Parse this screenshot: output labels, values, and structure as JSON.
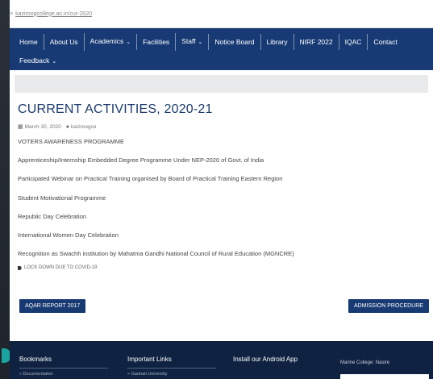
{
  "browser": {
    "url": "kaziroogcollege.ac.in/cur-2020"
  },
  "nav": {
    "row1": [
      {
        "label": "Home",
        "dropdown": false
      },
      {
        "label": "About Us",
        "dropdown": false
      },
      {
        "label": "Academics",
        "dropdown": true
      },
      {
        "label": "Facilities",
        "dropdown": false
      },
      {
        "label": "Staff",
        "dropdown": true
      },
      {
        "label": "Notice Board",
        "dropdown": false
      },
      {
        "label": "Library",
        "dropdown": false
      },
      {
        "label": "NIRF 2022",
        "dropdown": false
      },
      {
        "label": "IQAC",
        "dropdown": false
      },
      {
        "label": "Contact",
        "dropdown": false
      }
    ],
    "row2": [
      {
        "label": "Feedback",
        "dropdown": true
      }
    ]
  },
  "post": {
    "title": "CURRENT ACTIVITIES, 2020-21",
    "date": "March 30, 2020",
    "author": "kaziroogce",
    "items": [
      "VOTERS AWARENESS PROGRAMME",
      "Apprenticeship/Internship Embedded Degree Programme Under NEP-2020 of Govt. of India",
      "Participated Webinar on Practical Training organised by Board of Practical Training Eastern Region",
      "Student Motivational Programme",
      "Republic Day Celebration",
      "International Women Day Celebration",
      "Recognition as Swachh institution by Mahatma Gandhi National Council of Rural Education (MGNCRE)"
    ],
    "tag": "LOCK DOWN DUE TO COVID-19"
  },
  "buttons": {
    "aqar": "AQAR REPORT 2017",
    "admission": "ADMISSION PROCEDURE"
  },
  "footer": {
    "bookmarks_title": "Bookmarks",
    "bookmarks_first": "» Documentation",
    "links_title": "Important Links",
    "links_first": "» Gauhati University",
    "app_title": "Install our Android App",
    "college_label": "Marine College: Nasire"
  },
  "icons": {
    "date": "calendar-icon",
    "author": "user-icon",
    "tag": "tag-icon"
  },
  "colors": {
    "nav_bg": "#173a74",
    "title": "#1b3b6c",
    "button_bg": "#183a72",
    "footer_bg": "#0f2242"
  }
}
